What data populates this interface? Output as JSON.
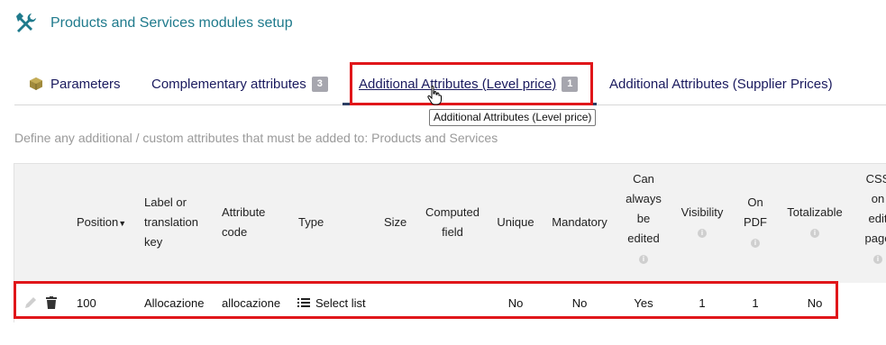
{
  "header": {
    "title": "Products and Services modules setup",
    "icon": "tools-icon"
  },
  "tabs": {
    "parameters": {
      "label": "Parameters",
      "icon": "box-icon"
    },
    "complementary": {
      "label": "Complementary attributes",
      "badge": "3"
    },
    "level_price": {
      "label": "Additional Attributes (Level price)",
      "badge": "1",
      "active": true
    },
    "supplier": {
      "label": "Additional Attributes (Supplier Prices)"
    }
  },
  "tooltip": "Additional Attributes (Level price)",
  "description": "Define any additional / custom attributes that must be added to: Products and Services",
  "table": {
    "headers": {
      "position": "Position",
      "label_1": "Label or",
      "label_2": "translation",
      "label_3": "key",
      "code_1": "Attribute",
      "code_2": "code",
      "type": "Type",
      "size": "Size",
      "computed_1": "Computed",
      "computed_2": "field",
      "unique": "Unique",
      "mandatory": "Mandatory",
      "edit_1": "Can",
      "edit_2": "always",
      "edit_3": "be",
      "edit_4": "edited",
      "visibility": "Visibility",
      "pdf_1": "On",
      "pdf_2": "PDF",
      "totalizable": "Totalizable",
      "css_1": "CSS",
      "css_2": "on",
      "css_3": "edit",
      "css_4": "page"
    },
    "rows": [
      {
        "position": "100",
        "label": "Allocazione",
        "code": "allocazione",
        "type": "Select list",
        "size": "",
        "computed": "",
        "unique": "No",
        "mandatory": "No",
        "always_edit": "Yes",
        "visibility": "1",
        "on_pdf": "1",
        "totalizable": "No"
      }
    ]
  },
  "colors": {
    "accent": "#1f7a8c",
    "highlight": "#e0161a",
    "badge": "#a6a6ae",
    "active_tab": "#2c3e63"
  }
}
